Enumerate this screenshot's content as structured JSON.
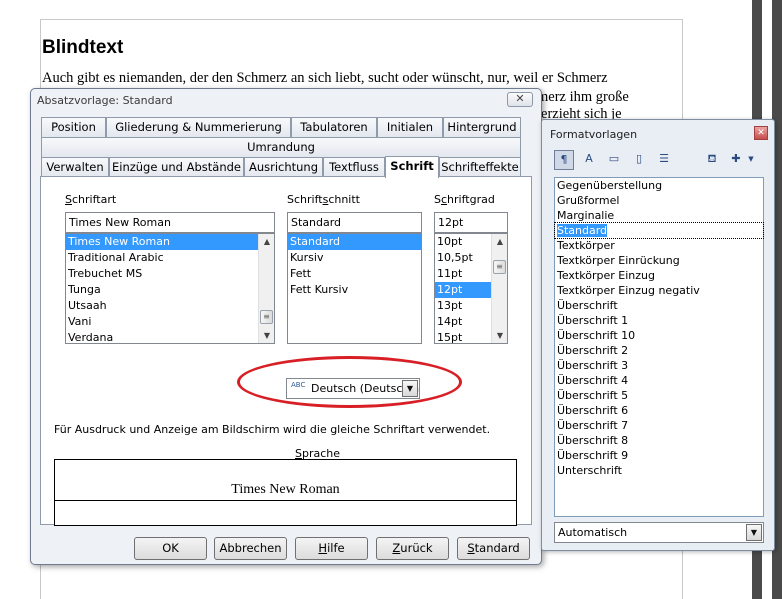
{
  "document": {
    "heading": "Blindtext",
    "line1": "Auch gibt es niemanden, der den Schmerz an sich liebt, sucht oder wünscht, nur, weil er Schmerz",
    "line2": "merz ihm große",
    "line3": "terzieht sich je"
  },
  "dialog": {
    "title": "Absatzvorlage: Standard",
    "close_glyph": "✕",
    "tabs_row1": [
      "Position",
      "Gliederung & Nummerierung",
      "Tabulatoren",
      "Initialen",
      "Hintergrund"
    ],
    "tabs_row2": [
      "Umrandung"
    ],
    "tabs_row3": [
      "Verwalten",
      "Einzüge und Abstände",
      "Ausrichtung",
      "Textfluss",
      "Schrift",
      "Schrifteffekte"
    ],
    "font": {
      "label_prefix": "S",
      "label_rest": "chriftart",
      "value": "Times New Roman",
      "items": [
        "Times New Roman",
        "Traditional Arabic",
        "Trebuchet MS",
        "Tunga",
        "Utsaah",
        "Vani",
        "Verdana"
      ],
      "selected": "Times New Roman"
    },
    "style": {
      "label_pre": "Schrift",
      "label_u": "s",
      "label_post": "chnitt",
      "value": "Standard",
      "items": [
        "Standard",
        "Kursiv",
        "Fett",
        "Fett Kursiv"
      ],
      "selected": "Standard"
    },
    "size": {
      "label_pre": "S",
      "label_u": "c",
      "label_post": "hriftgrad",
      "value": "12pt",
      "items": [
        "10pt",
        "10,5pt",
        "11pt",
        "12pt",
        "13pt",
        "14pt",
        "15pt"
      ],
      "selected": "12pt"
    },
    "language": {
      "label_u": "S",
      "label_rest": "prache",
      "abc": "ABC",
      "value": "Deutsch (Deutschland)"
    },
    "info_text": "Für Ausdruck und Anzeige am Bildschirm wird die gleiche Schriftart verwendet.",
    "preview_text": "Times New Roman",
    "buttons": {
      "ok": "OK",
      "cancel": "Abbrechen",
      "help_u": "H",
      "help_rest": "ilfe",
      "back_u": "Z",
      "back_rest": "urück",
      "standard_u": "S",
      "standard_rest": "tandard"
    }
  },
  "styles_panel": {
    "title": "Formatvorlagen",
    "close_glyph": "✕",
    "items": [
      "Gegenüberstellung",
      "Grußformel",
      "Marginalie",
      "Standard",
      "Textkörper",
      "Textkörper Einrückung",
      "Textkörper Einzug",
      "Textkörper Einzug negativ",
      "Überschrift",
      "Überschrift 1",
      "Überschrift 10",
      "Überschrift 2",
      "Überschrift 3",
      "Überschrift 4",
      "Überschrift 5",
      "Überschrift 6",
      "Überschrift 7",
      "Überschrift 8",
      "Überschrift 9",
      "Unterschrift"
    ],
    "selected": "Standard",
    "filter_value": "Automatisch"
  },
  "colors": {
    "selection": "#3399ff",
    "highlight_ellipse": "#d81f26"
  }
}
